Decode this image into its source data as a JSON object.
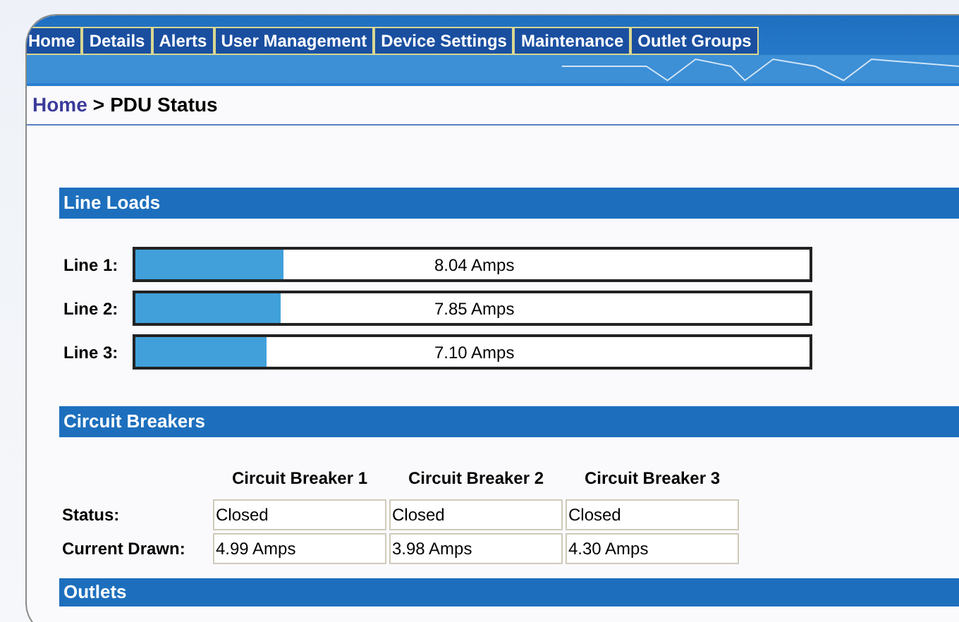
{
  "tabs": [
    {
      "label": "Home"
    },
    {
      "label": "Details"
    },
    {
      "label": "Alerts"
    },
    {
      "label": "User Management"
    },
    {
      "label": "Device Settings"
    },
    {
      "label": "Maintenance"
    },
    {
      "label": "Outlet Groups"
    }
  ],
  "breadcrumb": {
    "link": "Home",
    "separator": ">",
    "current": "PDU Status"
  },
  "line_loads": {
    "title": "Line Loads",
    "lines": [
      {
        "label": "Line 1:",
        "level": 0.22,
        "reading": "8.04 Amps"
      },
      {
        "label": "Line 2:",
        "level": 0.215,
        "reading": "7.85 Amps"
      },
      {
        "label": "Line 3:",
        "level": 0.195,
        "reading": "7.10 Amps"
      }
    ]
  },
  "circuit_breakers": {
    "title": "Circuit Breakers",
    "columns": [
      "Circuit Breaker 1",
      "Circuit Breaker 2",
      "Circuit Breaker 3"
    ],
    "rows": [
      {
        "label": "Status:",
        "cells": [
          "Closed",
          "Closed",
          "Closed"
        ]
      },
      {
        "label": "Current Drawn:",
        "cells": [
          "4.99 Amps",
          "3.98 Amps",
          "4.30 Amps"
        ]
      }
    ]
  },
  "outlets": {
    "title": "Outlets"
  }
}
